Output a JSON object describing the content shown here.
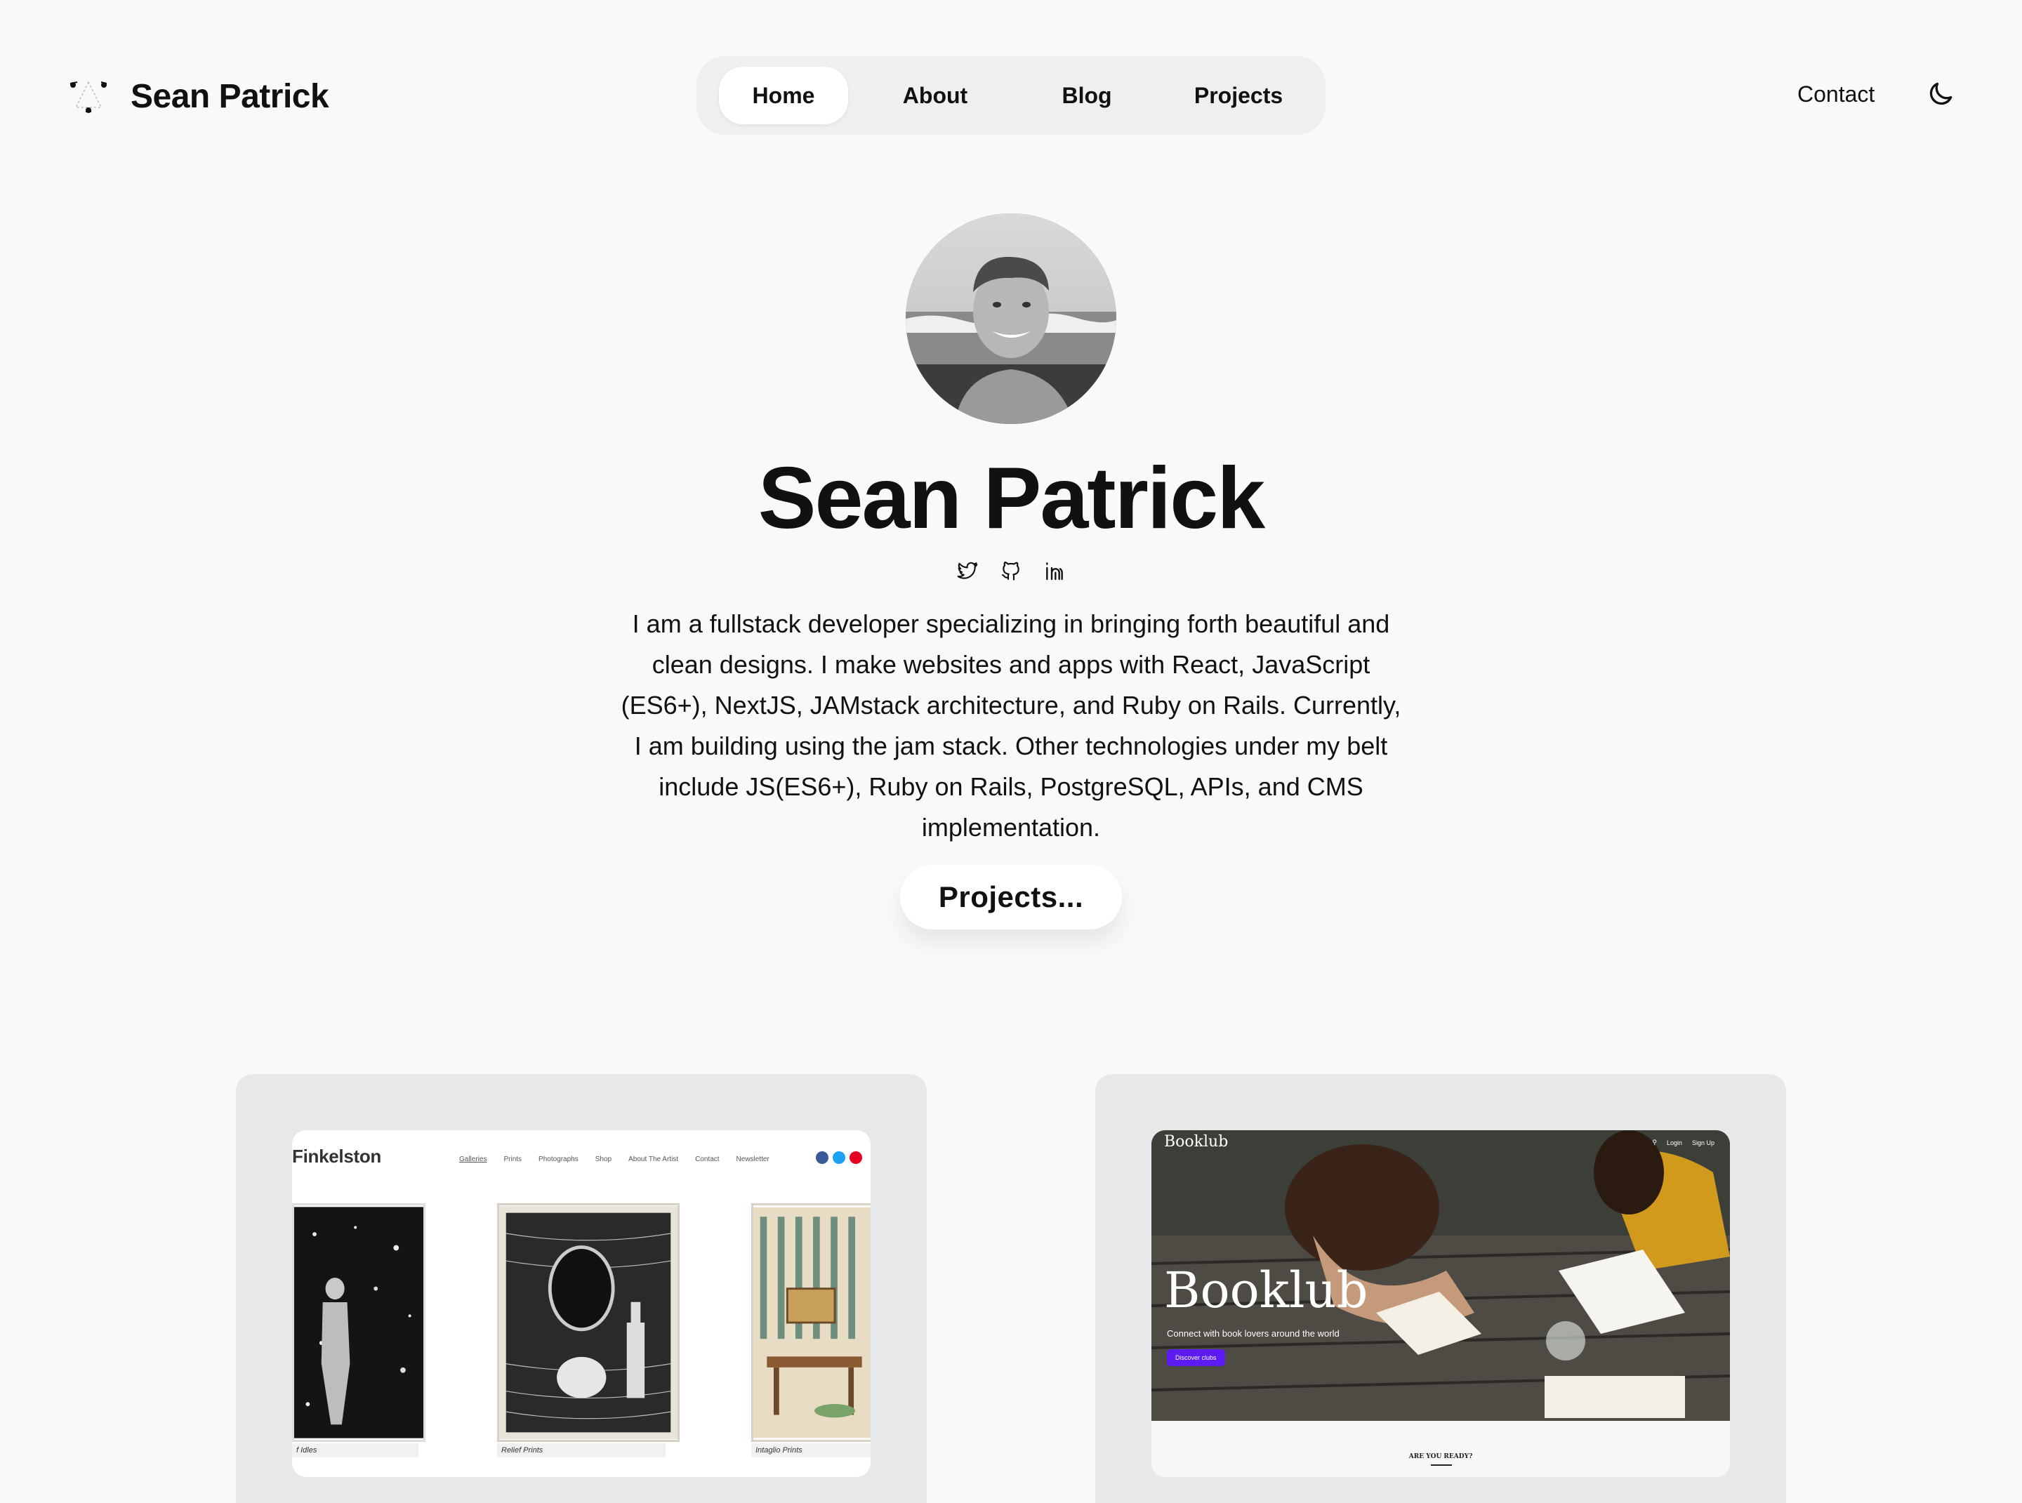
{
  "header": {
    "brand_name": "Sean Patrick",
    "nav": [
      {
        "label": "Home",
        "active": true
      },
      {
        "label": "About",
        "active": false
      },
      {
        "label": "Blog",
        "active": false
      },
      {
        "label": "Projects",
        "active": false
      }
    ],
    "contact_label": "Contact",
    "theme_icon": "moon-icon"
  },
  "hero": {
    "name": "Sean Patrick",
    "socials": [
      "twitter-icon",
      "github-icon",
      "linkedin-icon"
    ],
    "bio": "I am a fullstack developer specializing in bringing forth beautiful and clean designs. I make websites and apps with React, JavaScript (ES6+), NextJS, JAMstack architecture, and Ruby on Rails. Currently, I am building using the jam stack. Other technologies under my belt include JS(ES6+), Ruby on Rails, PostgreSQL, APIs, and CMS implementation.",
    "projects_button": "Projects..."
  },
  "projects": [
    {
      "site_title": "Finkelston",
      "nav": [
        "Galleries",
        "Prints",
        "Photographs",
        "Shop",
        "About The Artist",
        "Contact",
        "Newsletter"
      ],
      "captions": [
        "f Idles",
        "Relief Prints",
        "Intaglio Prints"
      ],
      "social_colors": [
        "#3b5998",
        "#1da1f2",
        "#e60023"
      ]
    },
    {
      "site_logo": "Booklub",
      "top_links": [
        "Login",
        "Sign Up"
      ],
      "hero_title": "Booklub",
      "subtitle": "Connect with book lovers around the world",
      "cta": "Discover clubs",
      "section_heading": "ARE YOU READY?",
      "accent": "#5b1bf2"
    }
  ],
  "colors": {
    "background": "#f8f9fb",
    "nav_pill": "#eeeff1",
    "card": "#e6e8e9"
  }
}
